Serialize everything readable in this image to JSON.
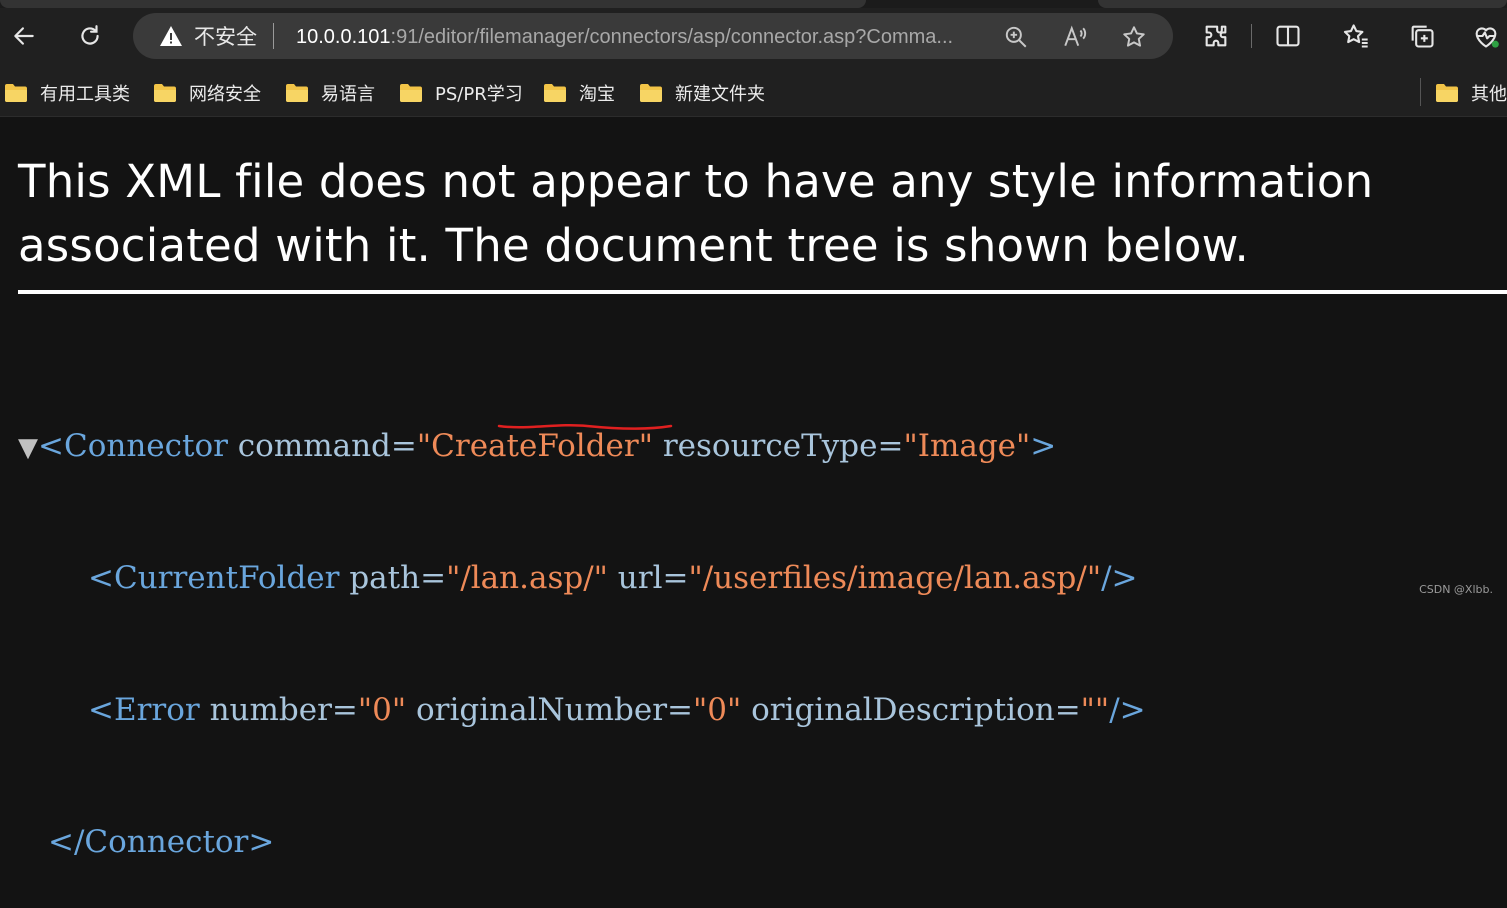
{
  "browser": {
    "security_label": "不安全",
    "url_host": "10.0.0.101",
    "url_rest": ":91/editor/filemanager/connectors/asp/connector.asp?Comma...",
    "icons": [
      "back-arrow-icon",
      "refresh-icon",
      "warning-icon",
      "zoom-icon",
      "read-aloud-icon",
      "favorite-star-icon",
      "extensions-icon",
      "split-screen-icon",
      "favorites-icon",
      "collections-icon",
      "browser-essentials-icon"
    ]
  },
  "bookmarks": [
    {
      "label": "有用工具类"
    },
    {
      "label": "网络安全"
    },
    {
      "label": "易语言"
    },
    {
      "label": "PS/PR学习"
    },
    {
      "label": "淘宝"
    },
    {
      "label": "新建文件夹"
    }
  ],
  "bookmarks_other": "其他",
  "content": {
    "notice": "This XML file does not appear to have any style information associated with it. The document tree is shown below.",
    "xml": {
      "toggle": "▼",
      "connector_open": "<Connector",
      "connector_attr1": "command=",
      "connector_val1": "\"CreateFolder\"",
      "connector_attr2": "resourceType=",
      "connector_val2": "\"Image\"",
      "connector_close_bracket": ">",
      "current_folder_open": "<CurrentFolder",
      "current_folder_attr1": "path=",
      "current_folder_val1": "\"/lan.asp/\"",
      "current_folder_attr2": "url=",
      "current_folder_val2": "\"/userfiles/image/lan.asp/\"",
      "current_folder_end": "/>",
      "error_open": "<Error",
      "error_attr1": "number=",
      "error_val1": "\"0\"",
      "error_attr2": "originalNumber=",
      "error_val2": "\"0\"",
      "error_attr3": "originalDescription=",
      "error_val3": "\"\"",
      "error_end": "/>",
      "connector_end": "</Connector>"
    }
  },
  "watermark": "CSDN @Xlbb.",
  "colors": {
    "background": "#131313",
    "chrome": "#202020",
    "tag": "#6aa6dd",
    "attribute": "#a9c5dc",
    "value": "#ee8a58",
    "annotation_underline": "#e02020"
  }
}
